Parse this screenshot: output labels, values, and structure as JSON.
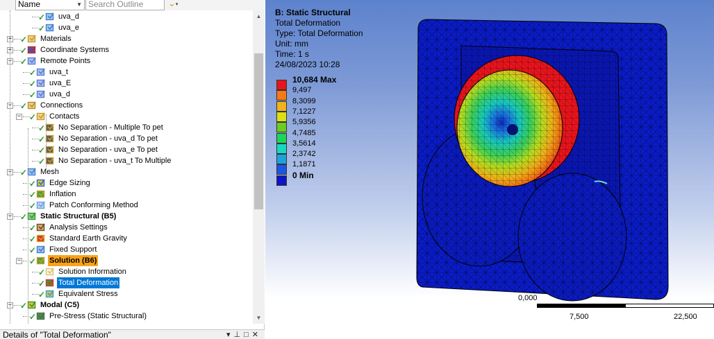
{
  "toolbar": {
    "name_value": "Name",
    "search_placeholder": "Search Outline"
  },
  "tree": {
    "items": [
      {
        "label": "uva_d",
        "icon": "named-selection-icon"
      },
      {
        "label": "uva_e",
        "icon": "named-selection-icon"
      },
      {
        "label": "Materials",
        "icon": "materials-icon"
      },
      {
        "label": "Coordinate Systems",
        "icon": "coordinate-systems-icon"
      },
      {
        "label": "Remote Points",
        "icon": "remote-points-icon"
      },
      {
        "label": "uva_t",
        "icon": "remote-point-icon"
      },
      {
        "label": "uva_E",
        "icon": "remote-point-icon"
      },
      {
        "label": "uva_d",
        "icon": "remote-point-icon"
      },
      {
        "label": "Connections",
        "icon": "connections-icon"
      },
      {
        "label": "Contacts",
        "icon": "contacts-folder-icon"
      },
      {
        "label": "No Separation - Multiple To pet",
        "icon": "contact-region-icon"
      },
      {
        "label": "No Separation - uva_d To pet",
        "icon": "contact-region-icon"
      },
      {
        "label": "No Separation - uva_e To pet",
        "icon": "contact-region-icon"
      },
      {
        "label": "No Separation - uva_t To Multiple",
        "icon": "contact-region-icon"
      },
      {
        "label": "Mesh",
        "icon": "mesh-icon"
      },
      {
        "label": "Edge Sizing",
        "icon": "edge-sizing-icon"
      },
      {
        "label": "Inflation",
        "icon": "inflation-icon"
      },
      {
        "label": "Patch Conforming Method",
        "icon": "patch-conforming-icon"
      },
      {
        "label": "Static Structural (B5)",
        "icon": "static-structural-icon"
      },
      {
        "label": "Analysis Settings",
        "icon": "analysis-settings-icon"
      },
      {
        "label": "Standard Earth Gravity",
        "icon": "gravity-icon"
      },
      {
        "label": "Fixed Support",
        "icon": "fixed-support-icon"
      },
      {
        "label": "Solution (B6)",
        "icon": "solution-icon"
      },
      {
        "label": "Solution Information",
        "icon": "solution-information-icon"
      },
      {
        "label": "Total Deformation",
        "icon": "total-deformation-icon"
      },
      {
        "label": "Equivalent Stress",
        "icon": "equivalent-stress-icon"
      },
      {
        "label": "Modal (C5)",
        "icon": "modal-icon"
      },
      {
        "label": "Pre-Stress (Static Structural)",
        "icon": "pre-stress-icon"
      }
    ]
  },
  "details": {
    "title": "Details of \"Total Deformation\""
  },
  "result": {
    "title": "B: Static Structural",
    "name": "Total Deformation",
    "type": "Type: Total Deformation",
    "unit": "Unit: mm",
    "time": "Time: 1 s",
    "date": "24/08/2023 10:28"
  },
  "legend": {
    "entries": [
      {
        "label": "10,684 Max",
        "color": "#e8141d"
      },
      {
        "label": "9,497",
        "color": "#f57a14"
      },
      {
        "label": "8,3099",
        "color": "#f2b21a"
      },
      {
        "label": "7,1227",
        "color": "#dede16"
      },
      {
        "label": "5,9356",
        "color": "#6ccc1f"
      },
      {
        "label": "4,7485",
        "color": "#1ad65b"
      },
      {
        "label": "3,5614",
        "color": "#17d8c3"
      },
      {
        "label": "2,3742",
        "color": "#1ea2dd"
      },
      {
        "label": "1,1871",
        "color": "#1c55e6"
      },
      {
        "label": "0 Min",
        "color": "#0c16c4"
      }
    ]
  },
  "scale_bar": {
    "labels": [
      "0,000",
      "7,500",
      "22,500"
    ]
  }
}
